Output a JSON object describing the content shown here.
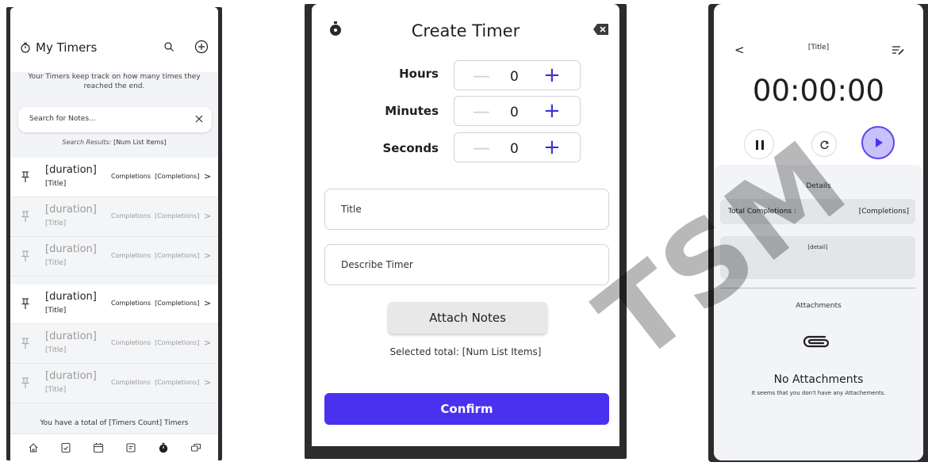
{
  "my_timers": {
    "title": "My Timers",
    "description": "Your Timers keep track on how many times they reached the end.",
    "search_placeholder": "Search for Notes...",
    "results_label": "Search Results:",
    "results_value": "[Num List Items]",
    "rows": [
      {
        "duration": "[duration]",
        "title": "[Title]",
        "completions_label": "Completions",
        "completions": "[Completions]",
        "chevron": ">"
      },
      {
        "duration": "[duration]",
        "title": "[Title]",
        "completions_label": "Completions",
        "completions": "[Completions]",
        "chevron": ">"
      },
      {
        "duration": "[duration]",
        "title": "[Title]",
        "completions_label": "Completions",
        "completions": "[Completions]",
        "chevron": ">"
      },
      {
        "duration": "[duration]",
        "title": "[Title]",
        "completions_label": "Completions",
        "completions": "[Completions]",
        "chevron": ">"
      },
      {
        "duration": "[duration]",
        "title": "[Title]",
        "completions_label": "Completions",
        "completions": "[Completions]",
        "chevron": ">"
      },
      {
        "duration": "[duration]",
        "title": "[Title]",
        "completions_label": "Completions",
        "completions": "[Completions]",
        "chevron": ">"
      }
    ],
    "total": "You have a total of [Timers Count] Timers",
    "nav_icons": [
      "home-icon",
      "checklist-icon",
      "calendar-icon",
      "notes-icon",
      "stopwatch-icon",
      "chat-icon"
    ]
  },
  "create_timer": {
    "title": "Create Timer",
    "hours_label": "Hours",
    "minutes_label": "Minutes",
    "seconds_label": "Seconds",
    "hours_value": "0",
    "minutes_value": "0",
    "seconds_value": "0",
    "minus": "—",
    "plus": "+",
    "title_placeholder": "Title",
    "describe_placeholder": "Describe Timer",
    "attach_label": "Attach Notes",
    "selected_total": "Selected total: [Num List Items]",
    "confirm_label": "Confirm",
    "accent": "#4a31ef"
  },
  "timer_detail": {
    "back": "<",
    "title": "[Title]",
    "clock": "00:00:00",
    "details_label": "Details",
    "total_completions_label": "Total Completions :",
    "total_completions_value": "[Completions]",
    "detail_text": "[detail]",
    "attachments_label": "Attachments",
    "no_attachments": "No Attachments",
    "no_attachments_sub": "It seems that you don't have any Attachements."
  },
  "watermark": "TSM"
}
